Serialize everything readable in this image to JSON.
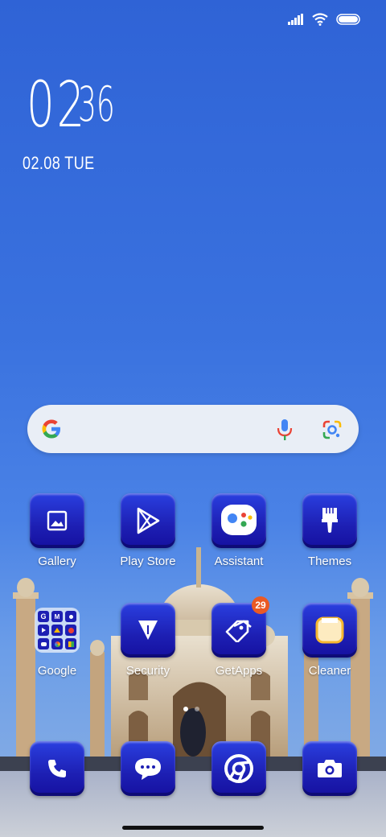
{
  "status": {
    "icons": [
      "signal-icon",
      "wifi-icon",
      "battery-icon"
    ]
  },
  "clock": {
    "hours": "02",
    "minutes": "36",
    "date": "02.08 TUE"
  },
  "search": {
    "left_icon": "google-g-icon",
    "mic_icon": "microphone-icon",
    "lens_icon": "google-lens-icon"
  },
  "apps": {
    "gallery": "Gallery",
    "play_store": "Play Store",
    "assistant": "Assistant",
    "themes": "Themes",
    "google": "Google",
    "security": "Security",
    "getapps": "GetApps",
    "getapps_badge": "29",
    "cleaner": "Cleaner"
  },
  "dock": [
    "phone-icon",
    "messages-icon",
    "chrome-icon",
    "camera-icon"
  ],
  "colors": {
    "tile": "#1d1fb3",
    "badge": "#ea5a24",
    "wallpaper": "#3a72df"
  }
}
